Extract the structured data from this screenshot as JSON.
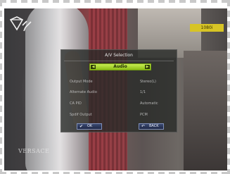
{
  "channel_badge": "1080i",
  "watermark": "VERSACE",
  "dialog": {
    "title": "A/V Selection",
    "tab": {
      "label": "Audio",
      "left_arrow_icon": "arrow-left-icon",
      "right_arrow_icon": "arrow-right-icon"
    },
    "options": [
      {
        "label": "Output Mode",
        "value": "Stereo(L)"
      },
      {
        "label": "Alternate Audio",
        "value": "1/1"
      },
      {
        "label": "CA PID",
        "value": "Automatic"
      },
      {
        "label": "Spdif Output",
        "value": "PCM"
      }
    ],
    "buttons": {
      "ok": {
        "icon": "checkmark-icon",
        "label": "OK"
      },
      "back": {
        "icon": "back-arrow-icon",
        "label": "BACK"
      }
    }
  },
  "colors": {
    "tab_accent": "#a6d62a",
    "badge": "#d7c425",
    "button": "#2b365c"
  }
}
